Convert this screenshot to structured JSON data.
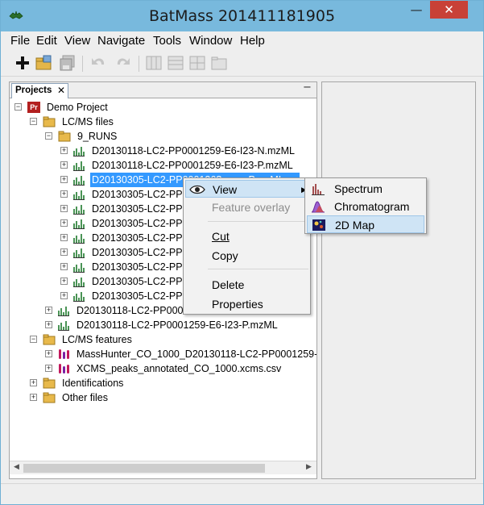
{
  "window": {
    "title": "BatMass 201411181905",
    "minimize_glyph": "—",
    "maximize_glyph": "☐",
    "close_glyph": "✕"
  },
  "menubar": [
    {
      "label": "File"
    },
    {
      "label": "Edit"
    },
    {
      "label": "View"
    },
    {
      "label": "Navigate"
    },
    {
      "label": "Tools"
    },
    {
      "label": "Window"
    },
    {
      "label": "Help"
    }
  ],
  "toolbar": {
    "items": [
      "new-icon",
      "open-project-icon",
      "save-all-icon",
      "undo-icon",
      "redo-icon",
      "layout-columns-icon",
      "layout-rows-icon",
      "layout-grid-icon",
      "folder-icon"
    ]
  },
  "projects_panel": {
    "tab_label": "Projects",
    "tab_close": "✕",
    "minimize": "−"
  },
  "tree": [
    {
      "label": "Demo Project",
      "badge": "Pr"
    },
    {
      "label": "LC/MS files"
    },
    {
      "label": "9_RUNS"
    },
    {
      "label": "D20130118-LC2-PP0001259-E6-I23-N.mzML"
    },
    {
      "label": "D20130118-LC2-PP0001259-E6-I23-P.mzML"
    },
    {
      "label": "D20130305-LC2-PP000126?-...-...-P.mzML"
    },
    {
      "label": "D20130305-LC2-PP000"
    },
    {
      "label": "D20130305-LC2-PP000"
    },
    {
      "label": "D20130305-LC2-PP000"
    },
    {
      "label": "D20130305-LC2-PP000"
    },
    {
      "label": "D20130305-LC2-PP000"
    },
    {
      "label": "D20130305-LC2-PP000"
    },
    {
      "label": "D20130305-LC2-PP000"
    },
    {
      "label": "D20130305-LC2-PP000"
    },
    {
      "label": "D20130118-LC2-PP000"
    },
    {
      "label": "D20130118-LC2-PP0001259-E6-I23-P.mzML"
    },
    {
      "label": "LC/MS features"
    },
    {
      "label": "MassHunter_CO_1000_D20130118-LC2-PP0001259-E"
    },
    {
      "label": "XCMS_peaks_annotated_CO_1000.xcms.csv"
    },
    {
      "label": "Identifications"
    },
    {
      "label": "Other files"
    }
  ],
  "context_menu": {
    "items": [
      {
        "label": "View",
        "submenu_arrow": "▶"
      },
      {
        "label": "Feature overlay"
      },
      {
        "label": "Cut"
      },
      {
        "label": "Copy"
      },
      {
        "label": "Delete"
      },
      {
        "label": "Properties"
      }
    ]
  },
  "submenu": {
    "items": [
      {
        "label": "Spectrum"
      },
      {
        "label": "Chromatogram"
      },
      {
        "label": "2D Map"
      }
    ]
  },
  "colors": {
    "titlebar": "#78b9dd",
    "close": "#c84137",
    "selection": "#3399ff",
    "highlight": "#cfe4f5"
  }
}
